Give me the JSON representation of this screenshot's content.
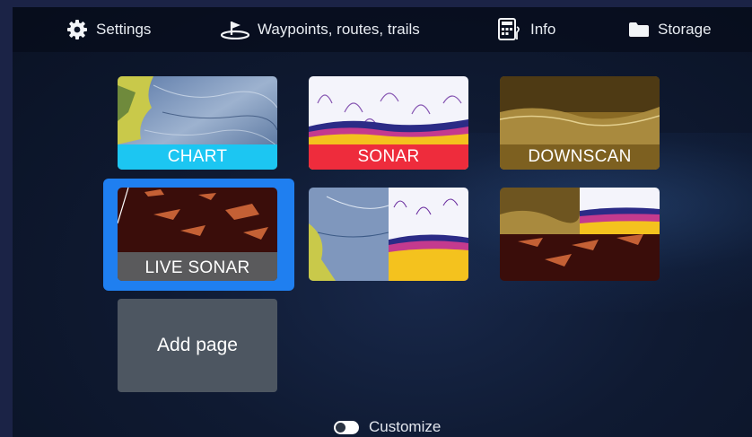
{
  "topbar": {
    "settings": {
      "label": "Settings",
      "icon": "gear-icon"
    },
    "waypoints": {
      "label": "Waypoints, routes, trails",
      "icon": "waypoint-flag-icon"
    },
    "info": {
      "label": "Info",
      "icon": "info-calculator-icon"
    },
    "storage": {
      "label": "Storage",
      "icon": "folder-icon"
    }
  },
  "tiles": {
    "chart": {
      "label": "CHART",
      "color": "#1cc6f2"
    },
    "sonar": {
      "label": "SONAR",
      "color": "#ee2c3c"
    },
    "downscan": {
      "label": "DOWNSCAN",
      "color": "#8a6a24"
    },
    "live_sonar": {
      "label": "LIVE SONAR",
      "color": "#5a5a5c",
      "selected": true
    }
  },
  "add_page": {
    "label": "Add page"
  },
  "customize": {
    "label": "Customize",
    "icon": "toggle-icon"
  },
  "colors": {
    "selection": "#1f7ff0",
    "frame": "#1b2346"
  }
}
